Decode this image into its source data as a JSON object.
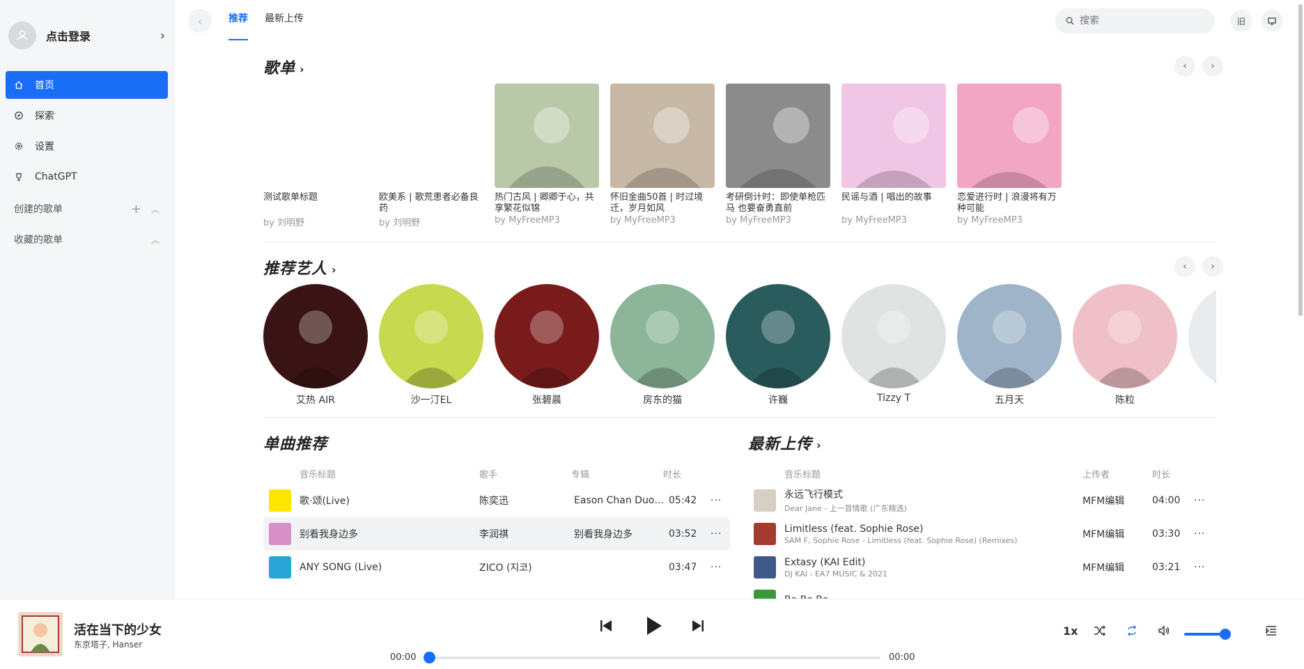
{
  "sidebar": {
    "login": "点击登录",
    "nav": [
      {
        "label": "首页",
        "icon": "home-icon"
      },
      {
        "label": "探索",
        "icon": "compass-icon"
      },
      {
        "label": "设置",
        "icon": "gear-icon"
      },
      {
        "label": "ChatGPT",
        "icon": "trophy-icon"
      }
    ],
    "created": "创建的歌单",
    "collected": "收藏的歌单"
  },
  "topbar": {
    "tabs": [
      "推荐",
      "最新上传"
    ],
    "search_placeholder": "搜索",
    "old_label": "旧"
  },
  "playlists": {
    "title": "歌单",
    "items": [
      {
        "title": "测试歌单标题",
        "by": "by 刘明野",
        "color": ""
      },
      {
        "title": "欧美系 | 歌荒患者必备良药",
        "by": "by 刘明野",
        "color": ""
      },
      {
        "title": "热门古风 | 卿卿于心，共享繁花似锦",
        "by": "by MyFreeMP3",
        "color": "#b9c9a8"
      },
      {
        "title": "怀旧金曲50首 | 时过境迁，岁月如风",
        "by": "by MyFreeMP3",
        "color": "#c8b8a6"
      },
      {
        "title": "考研倒计时：即使单枪匹马 也要奋勇直前",
        "by": "by MyFreeMP3",
        "color": "#8b8b8b"
      },
      {
        "title": "民谣与酒 | 唱出的故事",
        "by": "by MyFreeMP3",
        "color": "#f0c6e6"
      },
      {
        "title": "恋爱进行时 | 浪漫将有万种可能",
        "by": "by MyFreeMP3",
        "color": "#f3a6c4"
      }
    ]
  },
  "artists": {
    "title": "推荐艺人",
    "items": [
      {
        "name": "艾热 AIR",
        "color": "#3a1414"
      },
      {
        "name": "沙一汀EL",
        "color": "#c7d94e"
      },
      {
        "name": "张碧晨",
        "color": "#7a1b1b"
      },
      {
        "name": "房东的猫",
        "color": "#8cb59a"
      },
      {
        "name": "许巍",
        "color": "#2a5c5e"
      },
      {
        "name": "Tizzy T",
        "color": "#dfe3e2"
      },
      {
        "name": "五月天",
        "color": "#9fb4c8"
      },
      {
        "name": "陈粒",
        "color": "#f0c0c8"
      },
      {
        "name": "",
        "color": "#e8ecef"
      }
    ]
  },
  "songs": {
    "title": "单曲推荐",
    "headers": {
      "title": "音乐标题",
      "artist": "歌手",
      "album": "专辑",
      "duration": "时长"
    },
    "rows": [
      {
        "title": "歌·颂(Live)",
        "artist": "陈奕迅",
        "album": "Eason Chan Duo…",
        "duration": "05:42",
        "color": "#ffe600"
      },
      {
        "title": "别看我身边多",
        "artist": "李润祺",
        "album": "别看我身边多",
        "duration": "03:52",
        "color": "#d890c8"
      },
      {
        "title": "ANY SONG (Live)",
        "artist": "ZICO (지코)",
        "album": "",
        "duration": "03:47",
        "color": "#2aa5d8"
      }
    ]
  },
  "uploads": {
    "title": "最新上传",
    "headers": {
      "title": "音乐标题",
      "uploader": "上传者",
      "duration": "时长"
    },
    "rows": [
      {
        "title": "永远飞行模式",
        "sub": "Dear Jane - 上一首情歌 (广东精选)",
        "uploader": "MFM编辑",
        "duration": "04:00",
        "color": "#d8cfc4"
      },
      {
        "title": "Limitless (feat. Sophie Rose)",
        "sub": "SAM F, Sophie Rose - Limitless (feat. Sophie Rose) (Remixes)",
        "uploader": "MFM编辑",
        "duration": "03:30",
        "color": "#a53b2e"
      },
      {
        "title": "Extasy (KAI Edit)",
        "sub": "DJ KAI - EA7 MUSIC & 2021",
        "uploader": "MFM编辑",
        "duration": "03:21",
        "color": "#3f5a86"
      },
      {
        "title": "Ba Ba Ba",
        "sub": "",
        "uploader": "",
        "duration": "",
        "color": "#3a9a3a"
      }
    ]
  },
  "player": {
    "title": "活在当下的少女",
    "artist": "东京塔子, Hanser",
    "current": "00:00",
    "total": "00:00",
    "speed": "1x",
    "progress": 0,
    "volume": 0.9
  }
}
